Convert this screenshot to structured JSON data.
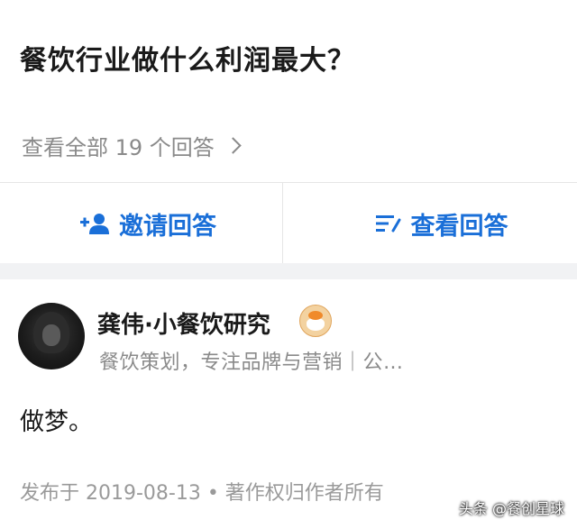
{
  "question": {
    "title": "餐饮行业做什么利润最大？",
    "view_all": "查看全部 19 个回答"
  },
  "actions": {
    "invite": "邀请回答",
    "view": "查看回答"
  },
  "answer": {
    "author_name": "龚伟·小餐饮研究",
    "author_bio": "餐饮策划，专注品牌与营销｜公…",
    "text": "做梦。",
    "meta": "发布于 2019-08-13 • 著作权归作者所有"
  },
  "watermark": "头条 @餐创星球",
  "colors": {
    "accent": "#1a6fd8",
    "secondary_text": "#8a8a8a"
  },
  "icons": [
    "add-user-icon",
    "list-icon",
    "chevron-right-icon",
    "author-badge-icon"
  ]
}
